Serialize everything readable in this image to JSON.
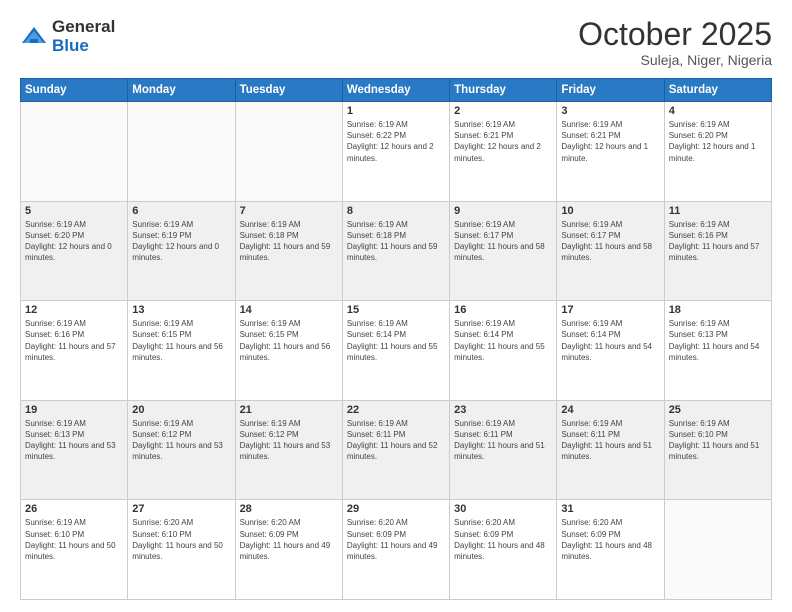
{
  "logo": {
    "general": "General",
    "blue": "Blue"
  },
  "header": {
    "month": "October 2025",
    "location": "Suleja, Niger, Nigeria"
  },
  "days_of_week": [
    "Sunday",
    "Monday",
    "Tuesday",
    "Wednesday",
    "Thursday",
    "Friday",
    "Saturday"
  ],
  "weeks": [
    [
      {
        "day": "",
        "info": ""
      },
      {
        "day": "",
        "info": ""
      },
      {
        "day": "",
        "info": ""
      },
      {
        "day": "1",
        "info": "Sunrise: 6:19 AM\nSunset: 6:22 PM\nDaylight: 12 hours and 2 minutes."
      },
      {
        "day": "2",
        "info": "Sunrise: 6:19 AM\nSunset: 6:21 PM\nDaylight: 12 hours and 2 minutes."
      },
      {
        "day": "3",
        "info": "Sunrise: 6:19 AM\nSunset: 6:21 PM\nDaylight: 12 hours and 1 minute."
      },
      {
        "day": "4",
        "info": "Sunrise: 6:19 AM\nSunset: 6:20 PM\nDaylight: 12 hours and 1 minute."
      }
    ],
    [
      {
        "day": "5",
        "info": "Sunrise: 6:19 AM\nSunset: 6:20 PM\nDaylight: 12 hours and 0 minutes."
      },
      {
        "day": "6",
        "info": "Sunrise: 6:19 AM\nSunset: 6:19 PM\nDaylight: 12 hours and 0 minutes."
      },
      {
        "day": "7",
        "info": "Sunrise: 6:19 AM\nSunset: 6:18 PM\nDaylight: 11 hours and 59 minutes."
      },
      {
        "day": "8",
        "info": "Sunrise: 6:19 AM\nSunset: 6:18 PM\nDaylight: 11 hours and 59 minutes."
      },
      {
        "day": "9",
        "info": "Sunrise: 6:19 AM\nSunset: 6:17 PM\nDaylight: 11 hours and 58 minutes."
      },
      {
        "day": "10",
        "info": "Sunrise: 6:19 AM\nSunset: 6:17 PM\nDaylight: 11 hours and 58 minutes."
      },
      {
        "day": "11",
        "info": "Sunrise: 6:19 AM\nSunset: 6:16 PM\nDaylight: 11 hours and 57 minutes."
      }
    ],
    [
      {
        "day": "12",
        "info": "Sunrise: 6:19 AM\nSunset: 6:16 PM\nDaylight: 11 hours and 57 minutes."
      },
      {
        "day": "13",
        "info": "Sunrise: 6:19 AM\nSunset: 6:15 PM\nDaylight: 11 hours and 56 minutes."
      },
      {
        "day": "14",
        "info": "Sunrise: 6:19 AM\nSunset: 6:15 PM\nDaylight: 11 hours and 56 minutes."
      },
      {
        "day": "15",
        "info": "Sunrise: 6:19 AM\nSunset: 6:14 PM\nDaylight: 11 hours and 55 minutes."
      },
      {
        "day": "16",
        "info": "Sunrise: 6:19 AM\nSunset: 6:14 PM\nDaylight: 11 hours and 55 minutes."
      },
      {
        "day": "17",
        "info": "Sunrise: 6:19 AM\nSunset: 6:14 PM\nDaylight: 11 hours and 54 minutes."
      },
      {
        "day": "18",
        "info": "Sunrise: 6:19 AM\nSunset: 6:13 PM\nDaylight: 11 hours and 54 minutes."
      }
    ],
    [
      {
        "day": "19",
        "info": "Sunrise: 6:19 AM\nSunset: 6:13 PM\nDaylight: 11 hours and 53 minutes."
      },
      {
        "day": "20",
        "info": "Sunrise: 6:19 AM\nSunset: 6:12 PM\nDaylight: 11 hours and 53 minutes."
      },
      {
        "day": "21",
        "info": "Sunrise: 6:19 AM\nSunset: 6:12 PM\nDaylight: 11 hours and 53 minutes."
      },
      {
        "day": "22",
        "info": "Sunrise: 6:19 AM\nSunset: 6:11 PM\nDaylight: 11 hours and 52 minutes."
      },
      {
        "day": "23",
        "info": "Sunrise: 6:19 AM\nSunset: 6:11 PM\nDaylight: 11 hours and 51 minutes."
      },
      {
        "day": "24",
        "info": "Sunrise: 6:19 AM\nSunset: 6:11 PM\nDaylight: 11 hours and 51 minutes."
      },
      {
        "day": "25",
        "info": "Sunrise: 6:19 AM\nSunset: 6:10 PM\nDaylight: 11 hours and 51 minutes."
      }
    ],
    [
      {
        "day": "26",
        "info": "Sunrise: 6:19 AM\nSunset: 6:10 PM\nDaylight: 11 hours and 50 minutes."
      },
      {
        "day": "27",
        "info": "Sunrise: 6:20 AM\nSunset: 6:10 PM\nDaylight: 11 hours and 50 minutes."
      },
      {
        "day": "28",
        "info": "Sunrise: 6:20 AM\nSunset: 6:09 PM\nDaylight: 11 hours and 49 minutes."
      },
      {
        "day": "29",
        "info": "Sunrise: 6:20 AM\nSunset: 6:09 PM\nDaylight: 11 hours and 49 minutes."
      },
      {
        "day": "30",
        "info": "Sunrise: 6:20 AM\nSunset: 6:09 PM\nDaylight: 11 hours and 48 minutes."
      },
      {
        "day": "31",
        "info": "Sunrise: 6:20 AM\nSunset: 6:09 PM\nDaylight: 11 hours and 48 minutes."
      },
      {
        "day": "",
        "info": ""
      }
    ]
  ]
}
